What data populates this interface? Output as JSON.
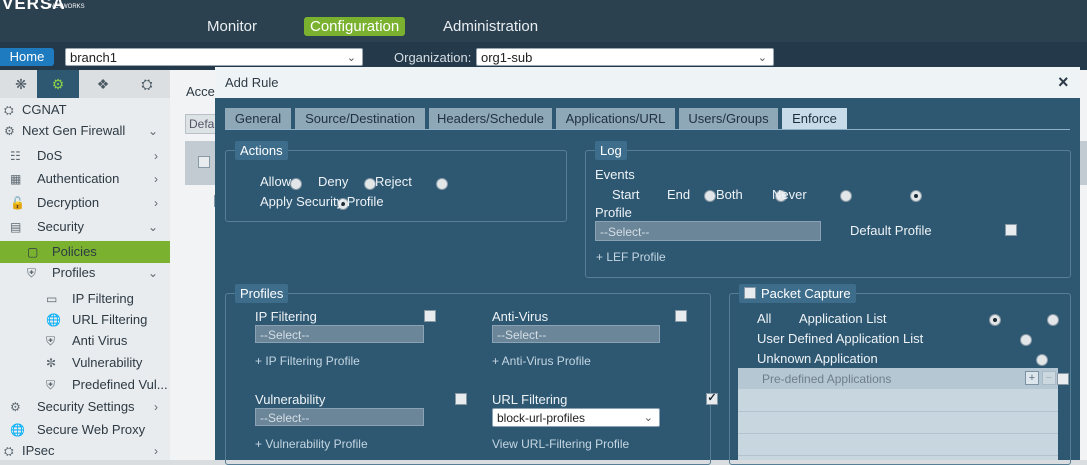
{
  "topnav": {
    "logo": "VERSA",
    "logo_sub": "NETWORKS",
    "items": [
      "Monitor",
      "Configuration",
      "Administration"
    ]
  },
  "bar2": {
    "home": "Home",
    "appliance": "branch1",
    "org_label": "Organization:",
    "org_value": "org1-sub"
  },
  "sidebar": {
    "items": [
      {
        "label": "CGNAT"
      },
      {
        "label": "Next Gen Firewall"
      },
      {
        "label": "DoS"
      },
      {
        "label": "Authentication"
      },
      {
        "label": "Decryption"
      },
      {
        "label": "Security"
      },
      {
        "label": "Policies"
      },
      {
        "label": "Profiles"
      },
      {
        "label": "IP Filtering"
      },
      {
        "label": "URL Filtering"
      },
      {
        "label": "Anti Virus"
      },
      {
        "label": "Vulnerability"
      },
      {
        "label": "Predefined Vul..."
      },
      {
        "label": "Security Settings"
      },
      {
        "label": "Secure Web Proxy"
      },
      {
        "label": "IPsec"
      }
    ]
  },
  "background": {
    "heading": "Acces",
    "filter": "Defa"
  },
  "modal": {
    "title": "Add Rule",
    "close": "×",
    "tabs": [
      "General",
      "Source/Destination",
      "Headers/Schedule",
      "Applications/URL",
      "Users/Groups",
      "Enforce"
    ],
    "active_tab": "Enforce",
    "actions": {
      "legend": "Actions",
      "options": [
        "Allow",
        "Deny",
        "Reject",
        "Apply Security Profile"
      ],
      "selected": "Apply Security Profile"
    },
    "log": {
      "legend": "Log",
      "events_label": "Events",
      "events": [
        "Start",
        "End",
        "Both",
        "Never"
      ],
      "selected": "Never",
      "profile_label": "Profile",
      "profile_placeholder": "--Select--",
      "default_profile": "Default Profile",
      "lef_link": "+ LEF Profile"
    },
    "profiles": {
      "legend": "Profiles",
      "ip_filtering": {
        "label": "IP Filtering",
        "checked": false,
        "value": "--Select--",
        "link": "+ IP Filtering Profile"
      },
      "anti_virus": {
        "label": "Anti-Virus",
        "checked": false,
        "value": "--Select--",
        "link": "+ Anti-Virus Profile"
      },
      "vulnerability": {
        "label": "Vulnerability",
        "checked": false,
        "value": "--Select--",
        "link": "+ Vulnerability Profile"
      },
      "url_filtering": {
        "label": "URL Filtering",
        "checked": true,
        "value": "block-url-profiles",
        "link": "View URL-Filtering Profile"
      }
    },
    "packet_capture": {
      "legend": "Packet Capture",
      "options": [
        "All",
        "Application List",
        "User Defined Application List",
        "Unknown Application"
      ],
      "selected": "All",
      "table_header": "Pre-defined Applications"
    }
  }
}
